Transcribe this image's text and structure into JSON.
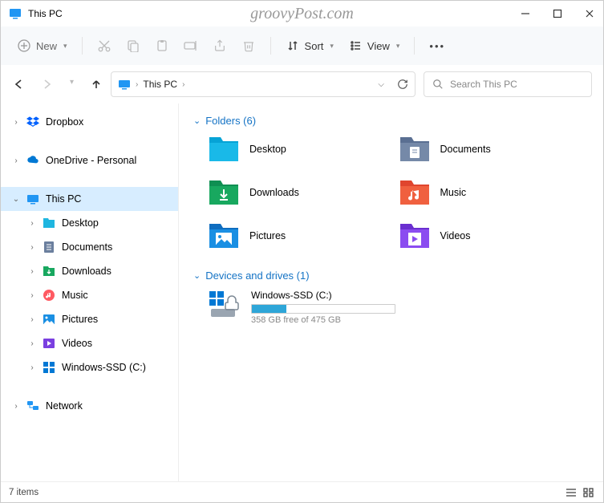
{
  "titlebar": {
    "title": "This PC",
    "watermark": "groovyPost.com"
  },
  "toolbar": {
    "new": "New",
    "sort": "Sort",
    "view": "View"
  },
  "address": {
    "crumb1": "This PC",
    "search_placeholder": "Search This PC"
  },
  "sidebar": {
    "dropbox": "Dropbox",
    "onedrive": "OneDrive - Personal",
    "thispc": "This PC",
    "desktop": "Desktop",
    "documents": "Documents",
    "downloads": "Downloads",
    "music": "Music",
    "pictures": "Pictures",
    "videos": "Videos",
    "ssd": "Windows-SSD (C:)",
    "network": "Network"
  },
  "folders": {
    "header": "Folders (6)",
    "desktop": "Desktop",
    "documents": "Documents",
    "downloads": "Downloads",
    "music": "Music",
    "pictures": "Pictures",
    "videos": "Videos"
  },
  "drives": {
    "header": "Devices and drives (1)",
    "ssd_name": "Windows-SSD (C:)",
    "ssd_free": "358 GB free of 475 GB"
  },
  "status": {
    "items": "7 items"
  }
}
